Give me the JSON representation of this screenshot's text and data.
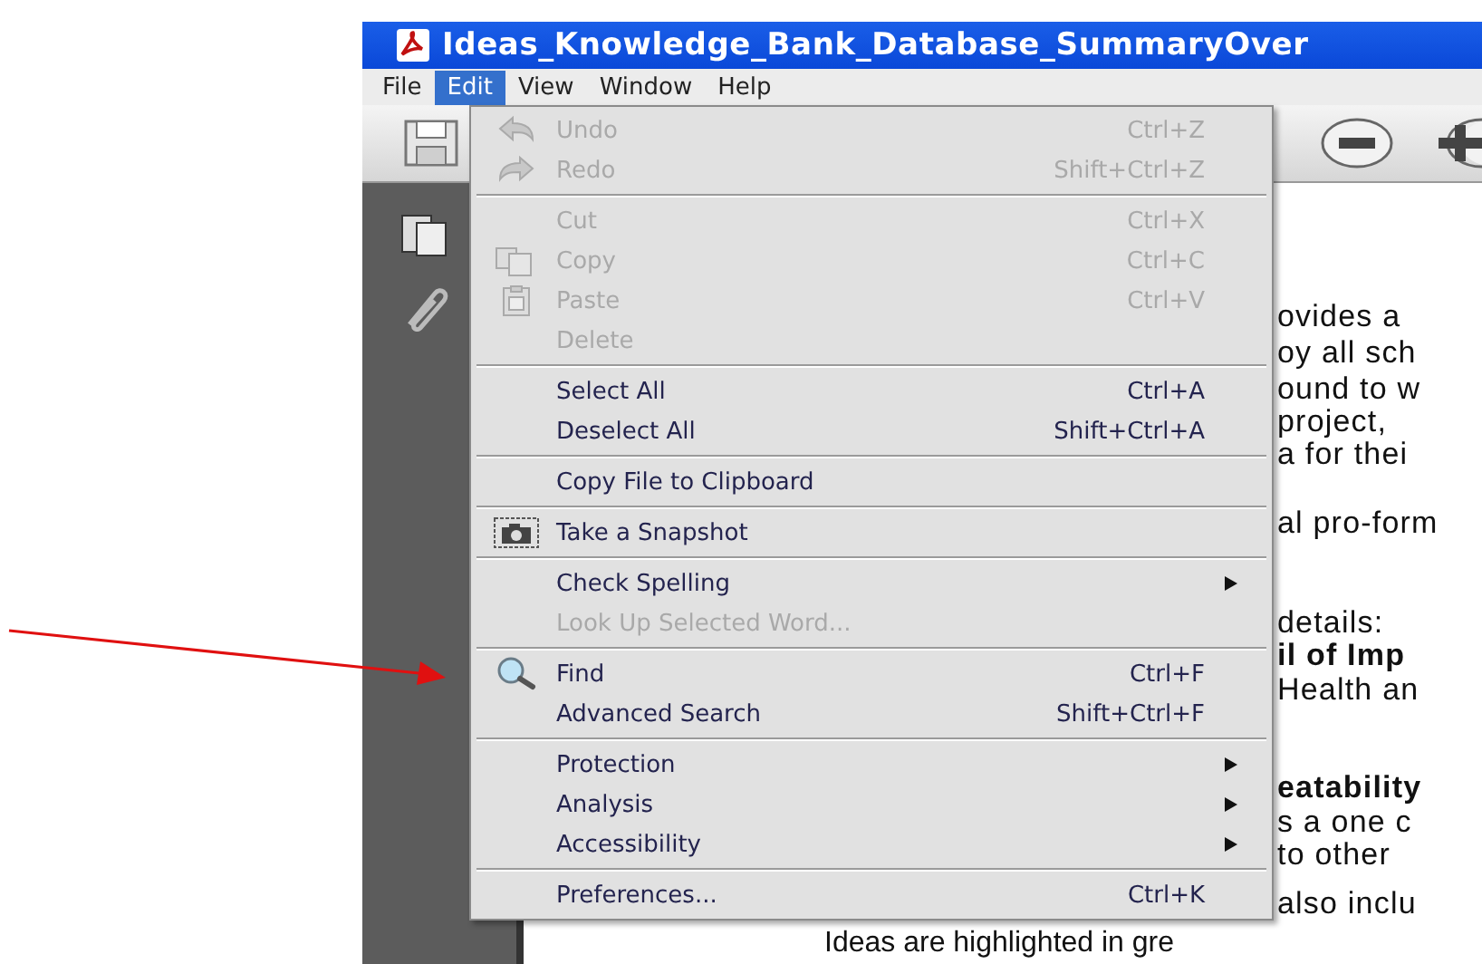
{
  "window": {
    "title": "Ideas_Knowledge_Bank_Database_SummaryOver"
  },
  "menu_bar": [
    {
      "label": "File",
      "selected": false
    },
    {
      "label": "Edit",
      "selected": true
    },
    {
      "label": "View",
      "selected": false
    },
    {
      "label": "Window",
      "selected": false
    },
    {
      "label": "Help",
      "selected": false
    }
  ],
  "edit_menu": [
    {
      "kind": "item",
      "label": "Undo",
      "shortcut": "Ctrl+Z",
      "disabled": true,
      "submenu": false
    },
    {
      "kind": "item",
      "label": "Redo",
      "shortcut": "Shift+Ctrl+Z",
      "disabled": true,
      "submenu": false
    },
    {
      "kind": "separator"
    },
    {
      "kind": "item",
      "label": "Cut",
      "shortcut": "Ctrl+X",
      "disabled": true,
      "submenu": false
    },
    {
      "kind": "item",
      "label": "Copy",
      "shortcut": "Ctrl+C",
      "disabled": true,
      "submenu": false
    },
    {
      "kind": "item",
      "label": "Paste",
      "shortcut": "Ctrl+V",
      "disabled": true,
      "submenu": false
    },
    {
      "kind": "item",
      "label": "Delete",
      "disabled": true,
      "submenu": false
    },
    {
      "kind": "separator"
    },
    {
      "kind": "item",
      "label": "Select All",
      "shortcut": "Ctrl+A",
      "disabled": false,
      "submenu": false
    },
    {
      "kind": "item",
      "label": "Deselect All",
      "shortcut": "Shift+Ctrl+A",
      "disabled": false,
      "submenu": false
    },
    {
      "kind": "separator"
    },
    {
      "kind": "item",
      "label": "Copy File to Clipboard",
      "disabled": false,
      "submenu": false
    },
    {
      "kind": "separator"
    },
    {
      "kind": "item",
      "label": "Take a Snapshot",
      "disabled": false,
      "submenu": false
    },
    {
      "kind": "separator"
    },
    {
      "kind": "item",
      "label": "Check Spelling",
      "disabled": false,
      "submenu": true
    },
    {
      "kind": "item",
      "label": "Look Up Selected Word...",
      "disabled": true,
      "submenu": false
    },
    {
      "kind": "separator"
    },
    {
      "kind": "item",
      "label": "Find",
      "shortcut": "Ctrl+F",
      "disabled": false,
      "submenu": false
    },
    {
      "kind": "item",
      "label": "Advanced Search",
      "shortcut": "Shift+Ctrl+F",
      "disabled": false,
      "submenu": false
    },
    {
      "kind": "separator"
    },
    {
      "kind": "item",
      "label": "Protection",
      "disabled": false,
      "submenu": true
    },
    {
      "kind": "item",
      "label": "Analysis",
      "disabled": false,
      "submenu": true
    },
    {
      "kind": "item",
      "label": "Accessibility",
      "disabled": false,
      "submenu": true
    },
    {
      "kind": "separator"
    },
    {
      "kind": "item",
      "label": "Preferences...",
      "shortcut": "Ctrl+K",
      "disabled": false,
      "submenu": false
    }
  ],
  "document_lines": [
    {
      "text": "ovides a",
      "bold": false
    },
    {
      "text": "oy all sch",
      "bold": false
    },
    {
      "text": "ound to w",
      "bold": false
    },
    {
      "text": "project,",
      "bold": false
    },
    {
      "text": "a for thei",
      "bold": false
    },
    {
      "text": "al pro-form",
      "bold": false
    },
    {
      "text": "details:",
      "bold": false
    },
    {
      "text": "il of Imp",
      "bold": true
    },
    {
      "text": "Health an",
      "bold": false
    },
    {
      "text": "eatability",
      "bold": true
    },
    {
      "text": "s a one c",
      "bold": false
    },
    {
      "text": "to other",
      "bold": false
    },
    {
      "text": "also inclu",
      "bold": false
    },
    {
      "text": "Ideas are highlighted in gre",
      "bold": false
    }
  ]
}
